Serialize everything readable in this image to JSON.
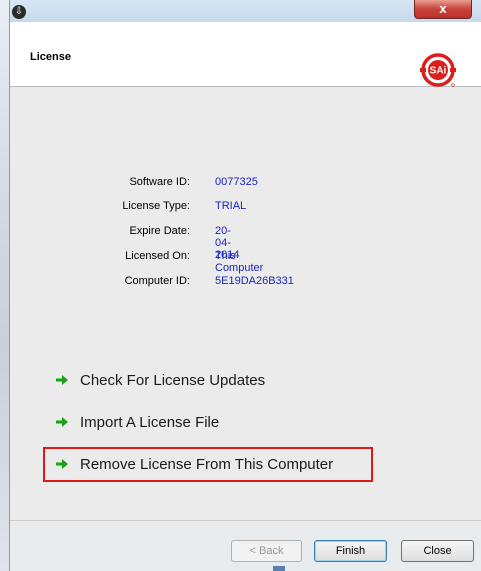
{
  "window": {
    "close_label": "x",
    "header_title": "License",
    "logo_text": "SAi"
  },
  "license_info": [
    {
      "label": "Software ID:",
      "value": "0077325"
    },
    {
      "label": "License Type:",
      "value": "TRIAL"
    },
    {
      "label": "Expire Date:",
      "value": "20-04-2014"
    },
    {
      "label": "Licensed On:",
      "value": "This Computer"
    },
    {
      "label": "Computer ID:",
      "value": "5E19DA26B331"
    }
  ],
  "actions": [
    {
      "label": "Check For License Updates"
    },
    {
      "label": "Import A License File"
    },
    {
      "label": "Remove License From This Computer"
    }
  ],
  "buttons": {
    "back": "< Back",
    "finish": "Finish",
    "close": "Close"
  },
  "colors": {
    "value_text": "#1a25c4",
    "arrow": "#1aa11a",
    "highlight": "#e01818",
    "logo": "#d9201c"
  },
  "icons": {
    "title": "app-icon",
    "action": "green-arrow-icon"
  }
}
